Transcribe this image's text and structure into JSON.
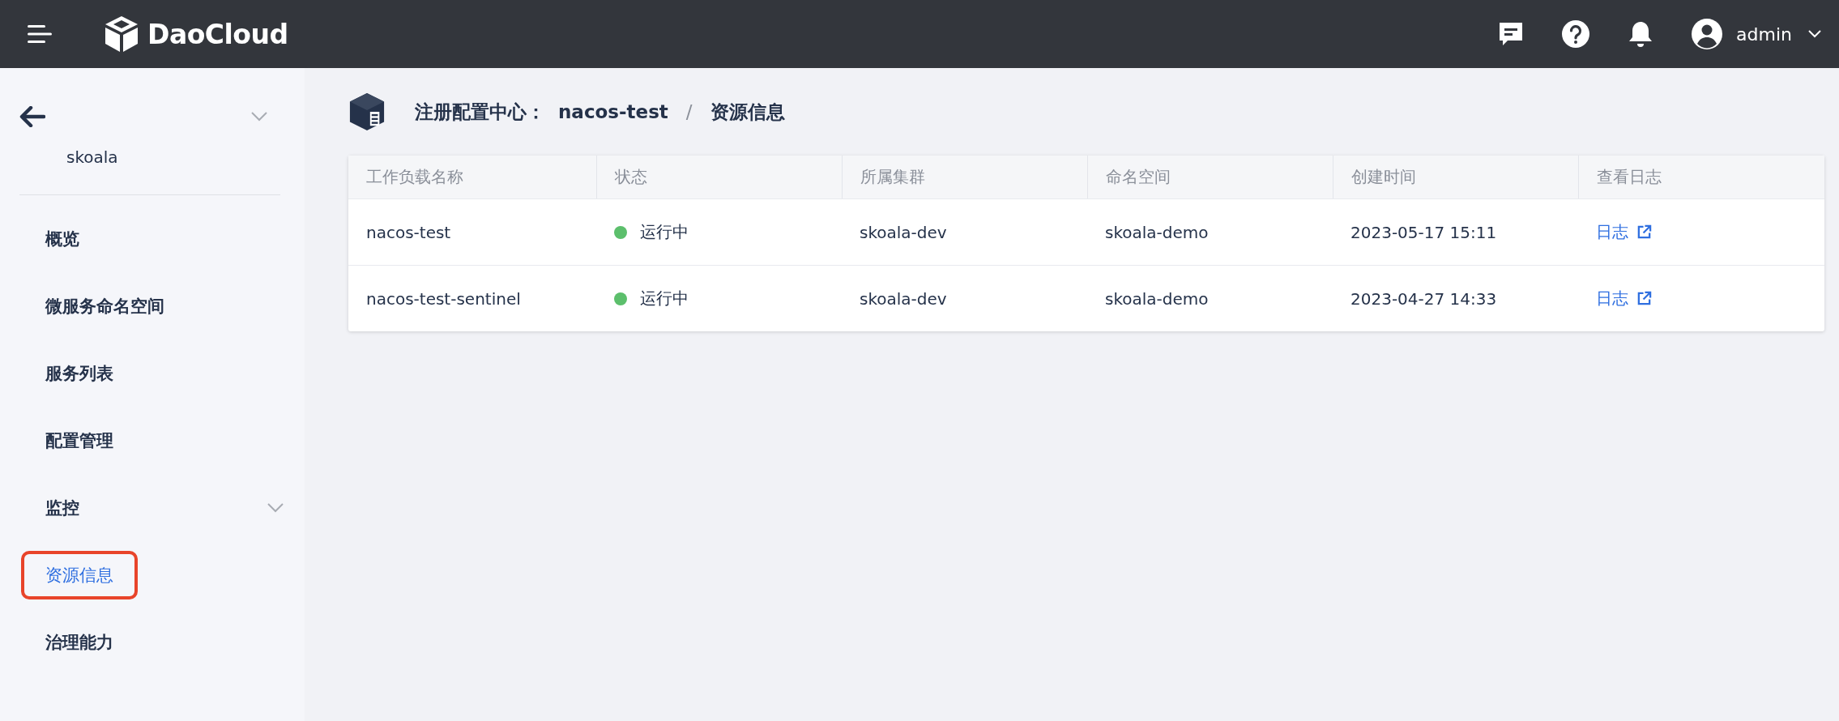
{
  "header": {
    "brand": "DaoCloud",
    "user": "admin"
  },
  "sidebar": {
    "context": "skoala",
    "items": [
      {
        "label": "概览",
        "kind": "link",
        "selected": false,
        "highlighted": false
      },
      {
        "label": "微服务命名空间",
        "kind": "link",
        "selected": false,
        "highlighted": false
      },
      {
        "label": "服务列表",
        "kind": "link",
        "selected": false,
        "highlighted": false
      },
      {
        "label": "配置管理",
        "kind": "link",
        "selected": false,
        "highlighted": false
      },
      {
        "label": "监控",
        "kind": "group",
        "selected": false,
        "highlighted": false
      },
      {
        "label": "资源信息",
        "kind": "link",
        "selected": true,
        "highlighted": true
      },
      {
        "label": "治理能力",
        "kind": "link",
        "selected": false,
        "highlighted": false
      }
    ]
  },
  "breadcrumb": {
    "parent": "注册配置中心：",
    "instance": "nacos-test",
    "separator": "/",
    "current": "资源信息"
  },
  "table": {
    "columns": [
      "工作负载名称",
      "状态",
      "所属集群",
      "命名空间",
      "创建时间",
      "查看日志"
    ],
    "rows": [
      {
        "name": "nacos-test",
        "status": "运行中",
        "color": "#5cbf6c",
        "cluster": "skoala-dev",
        "namespace": "skoala-demo",
        "created": "2023-05-17 15:11",
        "log": "日志"
      },
      {
        "name": "nacos-test-sentinel",
        "status": "运行中",
        "color": "#5cbf6c",
        "cluster": "skoala-dev",
        "namespace": "skoala-demo",
        "created": "2023-04-27 14:33",
        "log": "日志"
      }
    ]
  }
}
